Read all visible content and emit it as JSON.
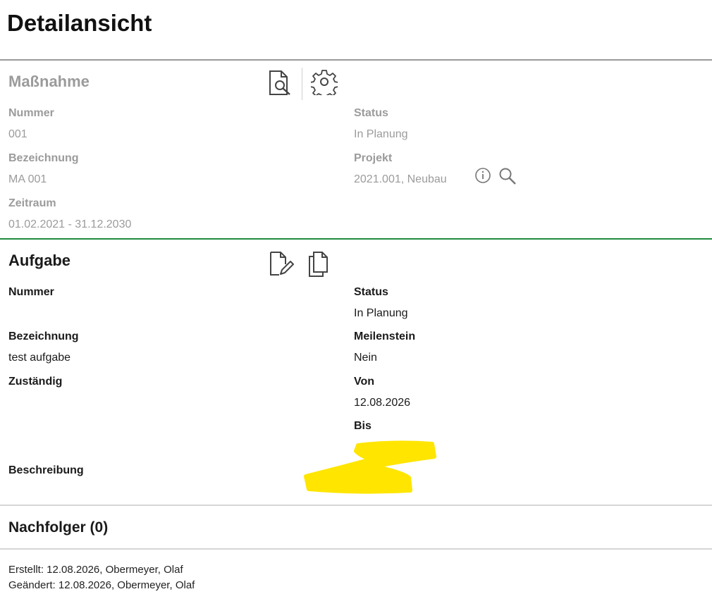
{
  "page": {
    "title": "Detailansicht"
  },
  "massnahme": {
    "title": "Maßnahme",
    "icons": [
      "document-search-icon",
      "gear-icon"
    ],
    "left": [
      {
        "label": "Nummer",
        "value": "001"
      },
      {
        "label": "Bezeichnung",
        "value": "MA 001"
      },
      {
        "label": "Zeitraum",
        "value": "01.02.2021 - 31.12.2030"
      }
    ],
    "right": [
      {
        "label": "Status",
        "value": "In Planung"
      },
      {
        "label": "Projekt",
        "value": "2021.001, Neubau"
      }
    ],
    "project_icons": [
      "info-icon",
      "search-icon"
    ]
  },
  "aufgabe": {
    "title": "Aufgabe",
    "icons": [
      "edit-document-icon",
      "copy-icon"
    ],
    "left": [
      {
        "label": "Nummer",
        "value": ""
      },
      {
        "label": "Bezeichnung",
        "value": "test aufgabe"
      },
      {
        "label": "Zuständig",
        "value": ""
      },
      {
        "label": "Beschreibung",
        "value": ""
      }
    ],
    "right": [
      {
        "label": "Status",
        "value": "In Planung"
      },
      {
        "label": "Meilenstein",
        "value": "Nein"
      },
      {
        "label": "Von",
        "value": "12.08.2026"
      },
      {
        "label": "Bis",
        "value": ""
      }
    ],
    "redaction_color": "#FFE500"
  },
  "nachfolger": {
    "title": "Nachfolger (0)"
  },
  "footer": {
    "created": "Erstellt:  12.08.2026, Obermeyer, Olaf",
    "changed": "Geändert:  12.08.2026, Obermeyer, Olaf"
  },
  "colors": {
    "section_rule_active": "#1E8A3C",
    "muted_text": "#9B9B9B"
  }
}
